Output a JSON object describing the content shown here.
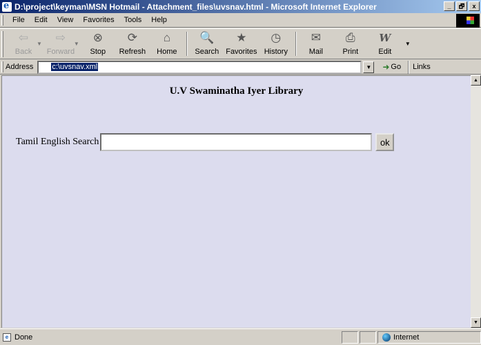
{
  "window": {
    "title": "D:\\project\\keyman\\MSN Hotmail - Attachment_files\\uvsnav.html - Microsoft Internet Explorer",
    "minimize_glyph": "_",
    "maximize_glyph": "🗗",
    "close_glyph": "x"
  },
  "menu": {
    "file": "File",
    "edit": "Edit",
    "view": "View",
    "favorites": "Favorites",
    "tools": "Tools",
    "help": "Help"
  },
  "toolbar": {
    "back": "Back",
    "forward": "Forward",
    "stop": "Stop",
    "refresh": "Refresh",
    "home": "Home",
    "search": "Search",
    "favorites": "Favorites",
    "history": "History",
    "mail": "Mail",
    "print": "Print",
    "edit": "Edit"
  },
  "address": {
    "label": "Address",
    "value": "c:\\uvsnav.xml",
    "go": "Go",
    "links": "Links"
  },
  "page": {
    "heading": "U.V Swaminatha Iyer Library",
    "search_label": "Tamil English Search",
    "search_value": "",
    "ok_label": "ok"
  },
  "status": {
    "text": "Done",
    "zone": "Internet"
  },
  "colors": {
    "content_bg": "#dcdcee",
    "title_start": "#0a246a",
    "title_end": "#a6caf0"
  }
}
